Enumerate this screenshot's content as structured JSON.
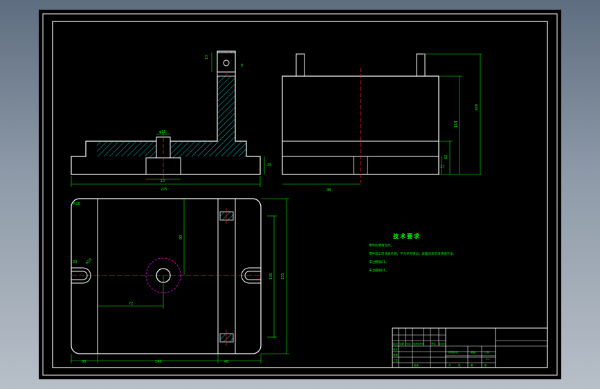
{
  "drawing": {
    "dims": {
      "front_h1": "13",
      "front_h2": "8",
      "front_bore": "φ16",
      "front_width": "225",
      "front_left": "12",
      "front_right": "26",
      "front_height": "25",
      "side_h1": "169",
      "side_h2": "118",
      "side_h3": "62",
      "side_h4": "22",
      "side_width": "96",
      "top_w1": "30",
      "top_w2": "140",
      "top_w3": "40",
      "top_h": "155",
      "top_h2": "130",
      "top_h3": "90",
      "top_x": "72",
      "top_r": "R10",
      "top_r2": "R20",
      "top_slot": "20"
    },
    "tech_requirements": {
      "title": "技术要求",
      "lines": [
        "零件的倒角均为。",
        "零件加工后须去毛刺，不允许有锐边，表面涂漆前须清理干净。",
        "未注倒角C1。",
        "未注圆角R1。"
      ]
    },
    "title_block": {
      "labels": [
        "标记",
        "处数",
        "分区",
        "更改文件号",
        "签名",
        "年月日",
        "设计",
        "审核",
        "工艺",
        "批准",
        "阶段标记",
        "重量",
        "比例",
        "共",
        "张",
        "第",
        "张",
        "1:1"
      ]
    }
  },
  "colors": {
    "background": "#000000",
    "outline": "#ffffff",
    "dimension": "#00ff00",
    "centerline": "#ff2020",
    "hatch": "#00d0d0",
    "hidden": "#ff00ff",
    "text": "#00ff00"
  }
}
